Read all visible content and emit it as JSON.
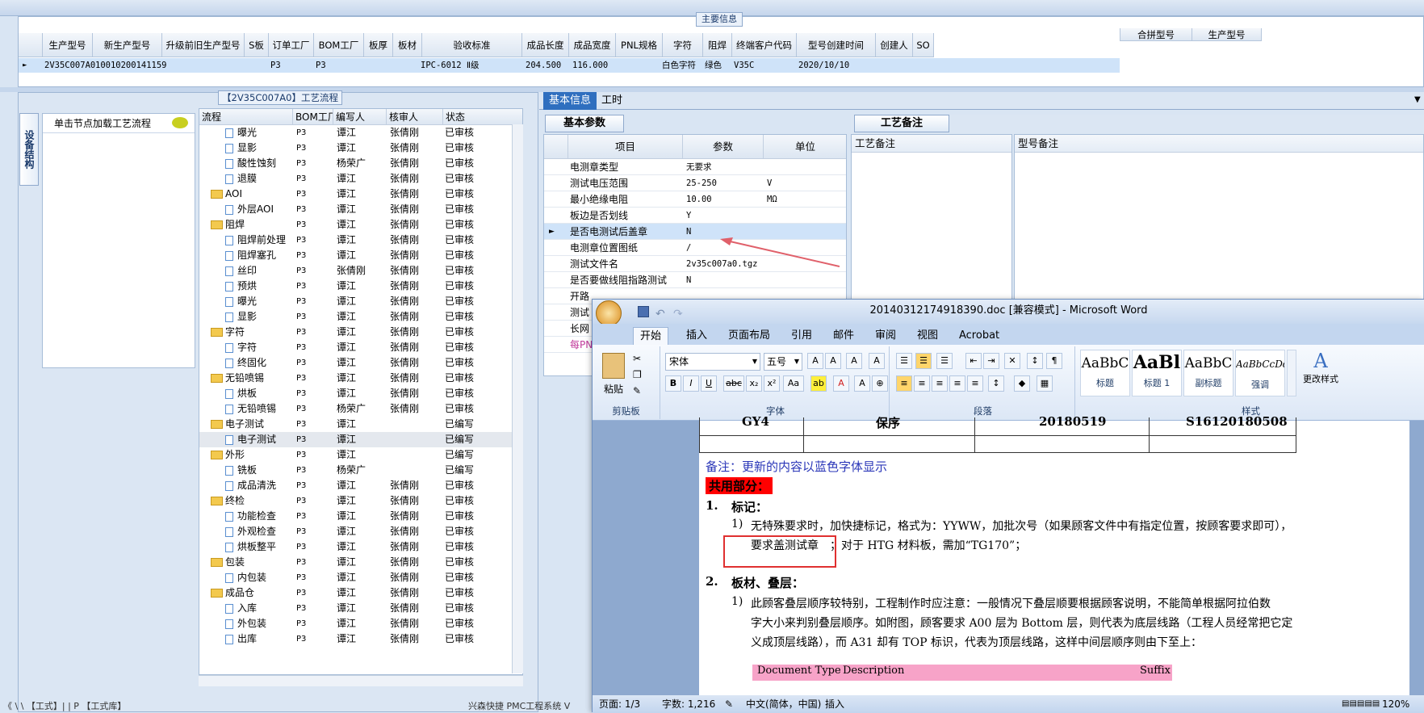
{
  "main_info": {
    "title": "主要信息",
    "columns": [
      "生产型号",
      "新生产型号",
      "升级前旧生产型号",
      "S板",
      "订单工厂",
      "BOM工厂",
      "板厚",
      "板材",
      "验收标准",
      "成品长度",
      "成品宽度",
      "PNL规格",
      "字符",
      "阻焊",
      "终端客户代码",
      "型号创建时间",
      "创建人",
      "SO"
    ],
    "row": [
      "2V35C007A0",
      "10010200141159",
      "",
      "",
      "P3",
      "P3",
      "",
      "",
      "IPC-6012 Ⅱ级",
      "204.500",
      "116.000",
      "",
      "白色字符",
      "绿色",
      "V35C",
      "2020/10/10",
      "",
      ""
    ],
    "right_columns": [
      "合拼型号",
      "生产型号"
    ]
  },
  "left_panel": {
    "side_tab": "设备结构",
    "node_hint": "单击节点加载工艺流程",
    "process_title": "【2V35C007A0】工艺流程",
    "tree_columns": [
      "流程",
      "BOM工厂",
      "编写人",
      "核审人",
      "状态"
    ],
    "tree_rows": [
      {
        "level": 2,
        "type": "doc",
        "name": "曝光",
        "bom": "P3",
        "writer": "谭江",
        "reviewer": "张倩刚",
        "status": "已审核"
      },
      {
        "level": 2,
        "type": "doc",
        "name": "显影",
        "bom": "P3",
        "writer": "谭江",
        "reviewer": "张倩刚",
        "status": "已审核"
      },
      {
        "level": 2,
        "type": "doc",
        "name": "酸性蚀刻",
        "bom": "P3",
        "writer": "杨荣广",
        "reviewer": "张倩刚",
        "status": "已审核"
      },
      {
        "level": 2,
        "type": "doc",
        "name": "退膜",
        "bom": "P3",
        "writer": "谭江",
        "reviewer": "张倩刚",
        "status": "已审核"
      },
      {
        "level": 1,
        "type": "folder",
        "name": "AOI",
        "bom": "P3",
        "writer": "谭江",
        "reviewer": "张倩刚",
        "status": "已审核"
      },
      {
        "level": 2,
        "type": "doc",
        "name": "外层AOI",
        "bom": "P3",
        "writer": "谭江",
        "reviewer": "张倩刚",
        "status": "已审核"
      },
      {
        "level": 1,
        "type": "folder",
        "name": "阻焊",
        "bom": "P3",
        "writer": "谭江",
        "reviewer": "张倩刚",
        "status": "已审核"
      },
      {
        "level": 2,
        "type": "doc",
        "name": "阻焊前处理",
        "bom": "P3",
        "writer": "谭江",
        "reviewer": "张倩刚",
        "status": "已审核"
      },
      {
        "level": 2,
        "type": "doc",
        "name": "阻焊塞孔",
        "bom": "P3",
        "writer": "谭江",
        "reviewer": "张倩刚",
        "status": "已审核"
      },
      {
        "level": 2,
        "type": "doc",
        "name": "丝印",
        "bom": "P3",
        "writer": "张倩刚",
        "reviewer": "张倩刚",
        "status": "已审核"
      },
      {
        "level": 2,
        "type": "doc",
        "name": "预烘",
        "bom": "P3",
        "writer": "谭江",
        "reviewer": "张倩刚",
        "status": "已审核"
      },
      {
        "level": 2,
        "type": "doc",
        "name": "曝光",
        "bom": "P3",
        "writer": "谭江",
        "reviewer": "张倩刚",
        "status": "已审核"
      },
      {
        "level": 2,
        "type": "doc",
        "name": "显影",
        "bom": "P3",
        "writer": "谭江",
        "reviewer": "张倩刚",
        "status": "已审核"
      },
      {
        "level": 1,
        "type": "folder",
        "name": "字符",
        "bom": "P3",
        "writer": "谭江",
        "reviewer": "张倩刚",
        "status": "已审核"
      },
      {
        "level": 2,
        "type": "doc",
        "name": "字符",
        "bom": "P3",
        "writer": "谭江",
        "reviewer": "张倩刚",
        "status": "已审核"
      },
      {
        "level": 2,
        "type": "doc",
        "name": "终固化",
        "bom": "P3",
        "writer": "谭江",
        "reviewer": "张倩刚",
        "status": "已审核"
      },
      {
        "level": 1,
        "type": "folder",
        "name": "无铅喷锡",
        "bom": "P3",
        "writer": "谭江",
        "reviewer": "张倩刚",
        "status": "已审核"
      },
      {
        "level": 2,
        "type": "doc",
        "name": "烘板",
        "bom": "P3",
        "writer": "谭江",
        "reviewer": "张倩刚",
        "status": "已审核"
      },
      {
        "level": 2,
        "type": "doc",
        "name": "无铅喷锡",
        "bom": "P3",
        "writer": "杨荣广",
        "reviewer": "张倩刚",
        "status": "已审核"
      },
      {
        "level": 1,
        "type": "folder",
        "name": "电子测试",
        "bom": "P3",
        "writer": "谭江",
        "reviewer": "",
        "status": "已编写"
      },
      {
        "level": 2,
        "type": "doc",
        "name": "电子测试",
        "bom": "P3",
        "writer": "谭江",
        "reviewer": "",
        "status": "已编写",
        "selected": true
      },
      {
        "level": 1,
        "type": "folder",
        "name": "外形",
        "bom": "P3",
        "writer": "谭江",
        "reviewer": "",
        "status": "已编写"
      },
      {
        "level": 2,
        "type": "doc",
        "name": "铣板",
        "bom": "P3",
        "writer": "杨荣广",
        "reviewer": "",
        "status": "已编写"
      },
      {
        "level": 2,
        "type": "doc",
        "name": "成品清洗",
        "bom": "P3",
        "writer": "谭江",
        "reviewer": "张倩刚",
        "status": "已审核"
      },
      {
        "level": 1,
        "type": "folder",
        "name": "终检",
        "bom": "P3",
        "writer": "谭江",
        "reviewer": "张倩刚",
        "status": "已审核"
      },
      {
        "level": 2,
        "type": "doc",
        "name": "功能检查",
        "bom": "P3",
        "writer": "谭江",
        "reviewer": "张倩刚",
        "status": "已审核"
      },
      {
        "level": 2,
        "type": "doc",
        "name": "外观检查",
        "bom": "P3",
        "writer": "谭江",
        "reviewer": "张倩刚",
        "status": "已审核"
      },
      {
        "level": 2,
        "type": "doc",
        "name": "烘板整平",
        "bom": "P3",
        "writer": "谭江",
        "reviewer": "张倩刚",
        "status": "已审核"
      },
      {
        "level": 1,
        "type": "folder",
        "name": "包装",
        "bom": "P3",
        "writer": "谭江",
        "reviewer": "张倩刚",
        "status": "已审核"
      },
      {
        "level": 2,
        "type": "doc",
        "name": "内包装",
        "bom": "P3",
        "writer": "谭江",
        "reviewer": "张倩刚",
        "status": "已审核"
      },
      {
        "level": 1,
        "type": "folder",
        "name": "成品仓",
        "bom": "P3",
        "writer": "谭江",
        "reviewer": "张倩刚",
        "status": "已审核"
      },
      {
        "level": 2,
        "type": "doc",
        "name": "入库",
        "bom": "P3",
        "writer": "谭江",
        "reviewer": "张倩刚",
        "status": "已审核"
      },
      {
        "level": 2,
        "type": "doc",
        "name": "外包装",
        "bom": "P3",
        "writer": "谭江",
        "reviewer": "张倩刚",
        "status": "已审核"
      },
      {
        "level": 2,
        "type": "doc",
        "name": "出库",
        "bom": "P3",
        "writer": "谭江",
        "reviewer": "张倩刚",
        "status": "已审核"
      }
    ]
  },
  "right_panel": {
    "tabs": [
      "基本信息",
      "工时"
    ],
    "subtab": "基本参数",
    "param_columns": [
      "项目",
      "参数",
      "单位"
    ],
    "params": [
      {
        "item": "电测章类型",
        "value": "无要求",
        "unit": ""
      },
      {
        "item": "测试电压范围",
        "value": "25-250",
        "unit": "V"
      },
      {
        "item": "最小绝缘电阻",
        "value": "10.00",
        "unit": "MΩ"
      },
      {
        "item": "板边是否划线",
        "value": "Y",
        "unit": ""
      },
      {
        "item": "是否电测试后盖章",
        "value": "N",
        "unit": "",
        "selected": true
      },
      {
        "item": "电测章位置图纸",
        "value": "/",
        "unit": ""
      },
      {
        "item": "测试文件名",
        "value": "2v35c007a0.tgz",
        "unit": ""
      },
      {
        "item": "是否要做线阻指路测试",
        "value": "N",
        "unit": ""
      },
      {
        "item": "开路",
        "value": "",
        "unit": ""
      },
      {
        "item": "测试",
        "value": "",
        "unit": ""
      },
      {
        "item": "长网",
        "value": "",
        "unit": ""
      },
      {
        "item": "每PN",
        "value": "",
        "unit": ""
      }
    ],
    "remark_tab": "工艺备注",
    "remark_col1": "工艺备注",
    "remark_col2": "型号备注"
  },
  "word": {
    "title": "20140312174918390.doc [兼容模式] - Microsoft Word",
    "tabs": [
      "开始",
      "插入",
      "页面布局",
      "引用",
      "邮件",
      "审阅",
      "视图",
      "Acrobat"
    ],
    "font_name": "宋体",
    "font_size": "五号",
    "groups": [
      "剪贴板",
      "字体",
      "段落",
      "样式"
    ],
    "paste": "粘贴",
    "styles": [
      {
        "preview": "AaBbC",
        "label": "标题"
      },
      {
        "preview": "AaBl",
        "label": "标题 1"
      },
      {
        "preview": "AaBbC",
        "label": "副标题"
      },
      {
        "preview": "AaBbCcDd",
        "label": "强调"
      }
    ],
    "change_style": "更改样式",
    "table_row": [
      "GY4",
      "保序",
      "20180519",
      "S16120180508"
    ],
    "note": "备注：更新的内容以蓝色字体显示",
    "common": "共用部分：",
    "h1": "1.",
    "h1_text": "标记：",
    "p1_num": "1)",
    "p1_line1": "无特殊要求时，加快捷标记，格式为：YYWW，加批次号（如果顾客文件中有指定位置，按顾客要求即可），",
    "p1_line2a": "要求盖测试章",
    "p1_line2b": "；对于 HTG 材料板，需加“TG170”；",
    "h2": "2.",
    "h2_text": "板材、叠层：",
    "p2_num": "1)",
    "p2_line1": "此顾客叠层顺序较特别，工程制作时应注意：一般情况下叠层顺要根据顾客说明，不能简单根据阿拉伯数",
    "p2_line2": "字大小来判别叠层顺序。如附图，顾客要求 A00 层为 Bottom 层，则代表为底层线路（工程人员经常把它定",
    "p2_line3": "义成顶层线路），而 A31 却有 TOP 标识，代表为顶层线路，这样中间层顺序则由下至上：",
    "table2_head": [
      "Document Type",
      "Description",
      "Suffix"
    ],
    "status_page": "页面: 1/3",
    "status_words": "字数: 1,216",
    "status_lang": "中文(简体，中国)",
    "status_insert": "插入",
    "zoom": "120%"
  },
  "bottom_left": "《 \\ \\ 【工式】| | P  【工式库】",
  "bottom_mid": "兴森快捷 PMC工程系统 V"
}
